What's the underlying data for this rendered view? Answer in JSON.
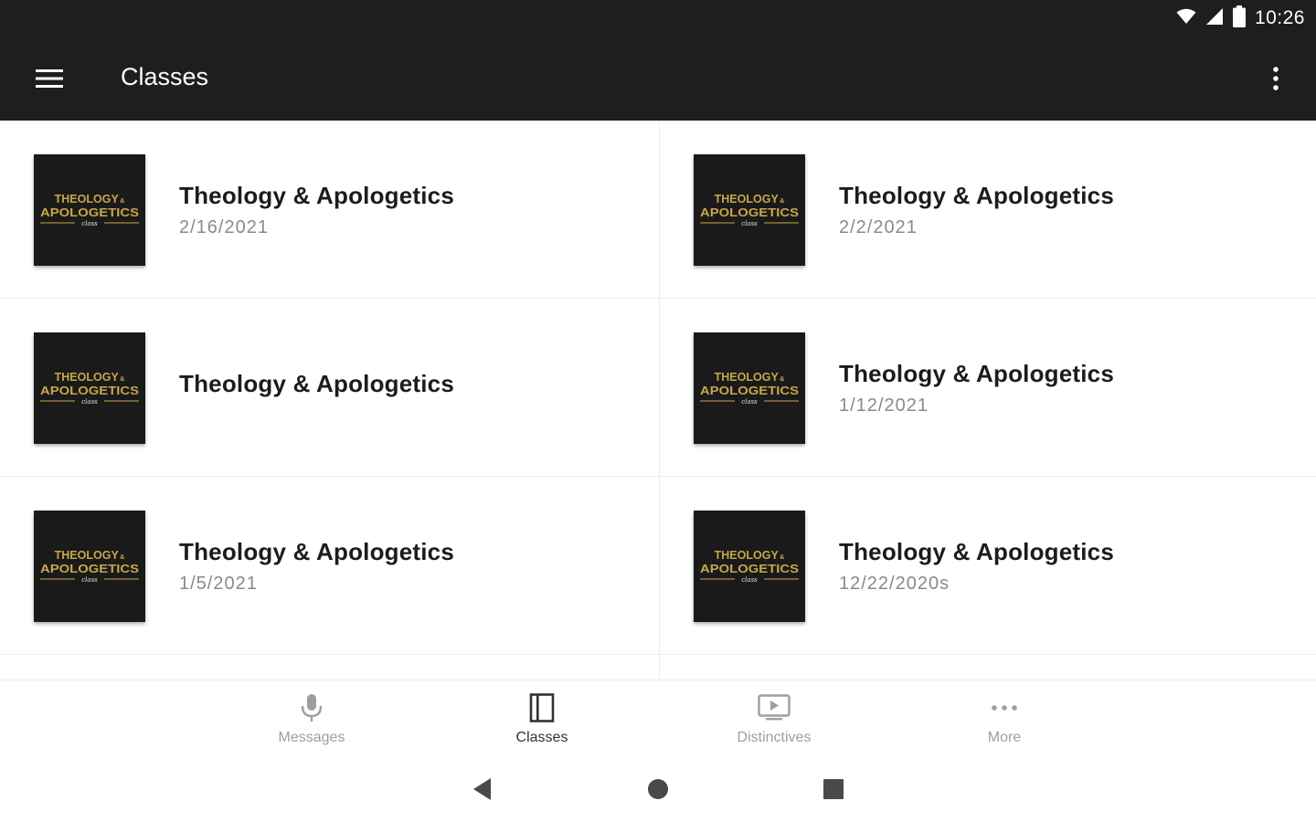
{
  "status_bar": {
    "time": "10:26"
  },
  "app_bar": {
    "title": "Classes"
  },
  "classes": [
    {
      "title": "Theology & Apologetics",
      "date": "2/16/2021"
    },
    {
      "title": "Theology & Apologetics",
      "date": "2/2/2021"
    },
    {
      "title": "Theology & Apologetics",
      "date": ""
    },
    {
      "title": "Theology & Apologetics",
      "date": "1/12/2021"
    },
    {
      "title": "Theology & Apologetics",
      "date": "1/5/2021"
    },
    {
      "title": "Theology & Apologetics",
      "date": "12/22/2020s"
    }
  ],
  "thumbnail": {
    "line1": "THEOLOGY",
    "amp": "&",
    "line2": "APOLOGETICS",
    "line3": "class"
  },
  "bottom_nav": {
    "items": [
      {
        "label": "Messages",
        "icon": "microphone-icon"
      },
      {
        "label": "Classes",
        "icon": "book-icon"
      },
      {
        "label": "Distinctives",
        "icon": "video-icon"
      },
      {
        "label": "More",
        "icon": "more-horizontal-icon"
      }
    ],
    "active_index": 1
  },
  "colors": {
    "app_bar": "#1e1e1e",
    "thumbnail_gold": "#c9a64b",
    "nav_inactive": "#9e9e9e",
    "nav_active": "#333333"
  }
}
